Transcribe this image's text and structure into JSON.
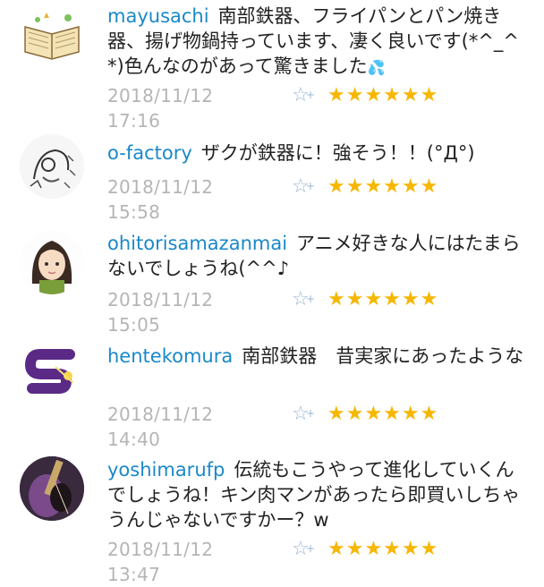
{
  "comments": [
    {
      "user": "mayusachi",
      "text": "南部鉄器、フライパンとパン焼き器、揚げ物鍋持っています、凄く良いです(*^_^*)色んなのがあって驚きました",
      "emoji": "💦",
      "date": "2018/11/12 17:16",
      "stars": "★★★★★★",
      "avatar": "book-avatar"
    },
    {
      "user": "o-factory",
      "text": "ザクが鉄器に！強そう！！(°Д°)",
      "date": "2018/11/12 15:58",
      "stars": "★★★★★★",
      "avatar": "sketch-avatar"
    },
    {
      "user": "ohitorisamazanmai",
      "text": "アニメ好きな人にはたまらないでしょうね(^^♪",
      "date": "2018/11/12 15:05",
      "stars": "★★★★★★",
      "avatar": "girl-avatar"
    },
    {
      "user": "hentekomura",
      "text": "南部鉄器　昔実家にあったような",
      "date": "2018/11/12 14:40",
      "stars": "★★★★★★",
      "avatar": "purple-s-avatar"
    },
    {
      "user": "yoshimarufp",
      "text": "伝統もこうやって進化していくんでしょうね！キン肉マンがあったら即買いしちゃうんじゃないですかー？w",
      "date": "2018/11/12 13:47",
      "stars": "★★★★★★",
      "avatar": "guitar-avatar"
    }
  ],
  "add_star_icon": "add-star-icon",
  "colors": {
    "username": "#1a88c9",
    "date": "#b5b5b5",
    "star": "#f6b700",
    "add_star": "#9ab7d3"
  }
}
